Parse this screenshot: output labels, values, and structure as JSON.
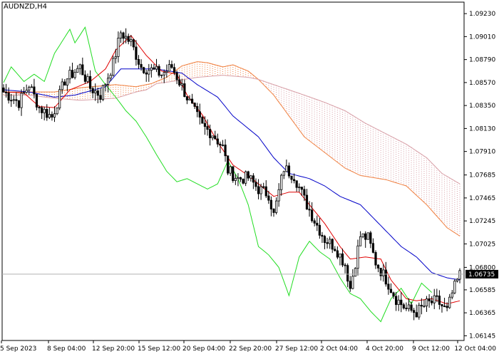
{
  "chart_data": {
    "type": "candlestick",
    "title": "AUDNZD,H4",
    "symbol": "AUDNZD",
    "timeframe": "H4",
    "ylim": [
      1.061,
      1.0934
    ],
    "y_ticks": [
      "1.09230",
      "1.09010",
      "1.08790",
      "1.08570",
      "1.08350",
      "1.08130",
      "1.07910",
      "1.07685",
      "1.07465",
      "1.07245",
      "1.07025",
      "1.06800",
      "1.06585",
      "1.06365",
      "1.06145"
    ],
    "x_ticks": [
      "5 Sep 2023",
      "8 Sep 04:00",
      "12 Sep 20:00",
      "15 Sep 12:00",
      "20 Sep 04:00",
      "22 Sep 20:00",
      "27 Sep 12:00",
      "2 Oct 04:00",
      "4 Oct 20:00",
      "9 Oct 12:00",
      "12 Oct 04:00"
    ],
    "current_price": "1.06735",
    "grid": false,
    "colors": {
      "bull_candle": "#000000",
      "bear_candle": "#000000",
      "tenkan_sen": "#e00000",
      "kijun_sen": "#0000c8",
      "chikou_span": "#22dd22",
      "cloud_bull": "#f08040",
      "cloud_bear": "#d8a0a8",
      "price_line": "#b0b0b0",
      "price_tag_bg": "#000000",
      "price_tag_text": "#ffffff"
    },
    "price_keyframes": [
      [
        0,
        1.0848
      ],
      [
        6,
        1.0838
      ],
      [
        10,
        1.0855
      ],
      [
        14,
        1.0833
      ],
      [
        19,
        1.0824
      ],
      [
        24,
        1.0859
      ],
      [
        30,
        1.0872
      ],
      [
        34,
        1.0852
      ],
      [
        38,
        1.0845
      ],
      [
        43,
        1.0875
      ],
      [
        46,
        1.0905
      ],
      [
        50,
        1.0895
      ],
      [
        54,
        1.0872
      ],
      [
        58,
        1.0869
      ],
      [
        62,
        1.0865
      ],
      [
        66,
        1.0872
      ],
      [
        70,
        1.0853
      ],
      [
        74,
        1.0833
      ],
      [
        78,
        1.0815
      ],
      [
        82,
        1.0808
      ],
      [
        86,
        1.0795
      ],
      [
        88,
        1.0773
      ],
      [
        92,
        1.0765
      ],
      [
        96,
        1.0766
      ],
      [
        100,
        1.0755
      ],
      [
        104,
        1.075
      ],
      [
        106,
        1.073
      ],
      [
        110,
        1.0775
      ],
      [
        114,
        1.0768
      ],
      [
        118,
        1.0745
      ],
      [
        122,
        1.0725
      ],
      [
        126,
        1.0707
      ],
      [
        130,
        1.07
      ],
      [
        134,
        1.0683
      ],
      [
        136,
        1.066
      ],
      [
        140,
        1.071
      ],
      [
        143,
        1.0708
      ],
      [
        146,
        1.0685
      ],
      [
        150,
        1.0669
      ],
      [
        154,
        1.065
      ],
      [
        158,
        1.064
      ],
      [
        162,
        1.0637
      ],
      [
        166,
        1.0645
      ],
      [
        170,
        1.0648
      ],
      [
        174,
        1.0638
      ],
      [
        176,
        1.0655
      ],
      [
        179,
        1.0673
      ]
    ],
    "tenkan_keyframes": [
      [
        0,
        1.0848
      ],
      [
        8,
        1.0847
      ],
      [
        14,
        1.0834
      ],
      [
        20,
        1.0833
      ],
      [
        26,
        1.085
      ],
      [
        34,
        1.0858
      ],
      [
        40,
        1.087
      ],
      [
        44,
        1.0888
      ],
      [
        50,
        1.0902
      ],
      [
        56,
        1.0883
      ],
      [
        62,
        1.0868
      ],
      [
        68,
        1.0865
      ],
      [
        72,
        1.0845
      ],
      [
        78,
        1.0826
      ],
      [
        84,
        1.08
      ],
      [
        90,
        1.0778
      ],
      [
        96,
        1.0768
      ],
      [
        100,
        1.076
      ],
      [
        106,
        1.0748
      ],
      [
        112,
        1.0752
      ],
      [
        116,
        1.0752
      ],
      [
        120,
        1.074
      ],
      [
        126,
        1.0722
      ],
      [
        132,
        1.07
      ],
      [
        136,
        1.0688
      ],
      [
        142,
        1.069
      ],
      [
        148,
        1.0688
      ],
      [
        152,
        1.0668
      ],
      [
        158,
        1.065
      ],
      [
        162,
        1.0648
      ],
      [
        168,
        1.065
      ],
      [
        174,
        1.0645
      ],
      [
        179,
        1.0648
      ]
    ],
    "kijun_keyframes": [
      [
        0,
        1.085
      ],
      [
        10,
        1.0848
      ],
      [
        20,
        1.0843
      ],
      [
        28,
        1.0845
      ],
      [
        40,
        1.0853
      ],
      [
        46,
        1.087
      ],
      [
        60,
        1.087
      ],
      [
        70,
        1.0866
      ],
      [
        76,
        1.0855
      ],
      [
        84,
        1.0843
      ],
      [
        90,
        1.0825
      ],
      [
        100,
        1.0805
      ],
      [
        106,
        1.0785
      ],
      [
        112,
        1.077
      ],
      [
        120,
        1.0765
      ],
      [
        126,
        1.0758
      ],
      [
        132,
        1.0748
      ],
      [
        140,
        1.074
      ],
      [
        148,
        1.072
      ],
      [
        156,
        1.07
      ],
      [
        162,
        1.069
      ],
      [
        168,
        1.0675
      ],
      [
        174,
        1.067
      ],
      [
        179,
        1.0668
      ]
    ],
    "chikou_keyframes": [
      [
        0,
        1.0857
      ],
      [
        3,
        1.0872
      ],
      [
        8,
        1.0858
      ],
      [
        12,
        1.0865
      ],
      [
        16,
        1.0858
      ],
      [
        20,
        1.0885
      ],
      [
        26,
        1.0908
      ],
      [
        28,
        1.0895
      ],
      [
        32,
        1.091
      ],
      [
        36,
        1.0868
      ],
      [
        40,
        1.0855
      ],
      [
        44,
        1.0843
      ],
      [
        48,
        1.083
      ],
      [
        52,
        1.082
      ],
      [
        56,
        1.0805
      ],
      [
        60,
        1.0788
      ],
      [
        64,
        1.0772
      ],
      [
        68,
        1.0762
      ],
      [
        72,
        1.0765
      ],
      [
        76,
        1.076
      ],
      [
        80,
        1.0755
      ],
      [
        84,
        1.076
      ],
      [
        88,
        1.0782
      ],
      [
        92,
        1.0765
      ],
      [
        96,
        1.074
      ],
      [
        100,
        1.07
      ],
      [
        104,
        1.0692
      ],
      [
        108,
        1.068
      ],
      [
        112,
        1.0653
      ],
      [
        116,
        1.069
      ],
      [
        120,
        1.0705
      ],
      [
        124,
        1.0695
      ],
      [
        128,
        1.0688
      ],
      [
        132,
        1.067
      ],
      [
        136,
        1.0655
      ],
      [
        140,
        1.065
      ],
      [
        144,
        1.0638
      ],
      [
        148,
        1.0628
      ],
      [
        152,
        1.065
      ],
      [
        156,
        1.066
      ],
      [
        160,
        1.0645
      ],
      [
        162,
        1.0655
      ],
      [
        164,
        1.0665
      ],
      [
        168,
        1.0656
      ]
    ],
    "senkou_a_keyframes": [
      [
        0,
        1.0848
      ],
      [
        10,
        1.0848
      ],
      [
        20,
        1.0848
      ],
      [
        30,
        1.0852
      ],
      [
        44,
        1.0855
      ],
      [
        52,
        1.0853
      ],
      [
        58,
        1.0856
      ],
      [
        64,
        1.0862
      ],
      [
        70,
        1.0873
      ],
      [
        76,
        1.0877
      ],
      [
        80,
        1.0876
      ],
      [
        86,
        1.0872
      ],
      [
        90,
        1.0874
      ],
      [
        96,
        1.0868
      ],
      [
        100,
        1.086
      ],
      [
        106,
        1.0845
      ],
      [
        112,
        1.0825
      ],
      [
        118,
        1.0805
      ],
      [
        126,
        1.079
      ],
      [
        134,
        1.0775
      ],
      [
        140,
        1.0768
      ],
      [
        150,
        1.0764
      ],
      [
        158,
        1.0758
      ],
      [
        166,
        1.074
      ],
      [
        174,
        1.0718
      ],
      [
        179,
        1.071
      ]
    ],
    "senkou_b_keyframes": [
      [
        0,
        1.0845
      ],
      [
        10,
        1.0845
      ],
      [
        20,
        1.0842
      ],
      [
        30,
        1.084
      ],
      [
        44,
        1.0842
      ],
      [
        52,
        1.0848
      ],
      [
        56,
        1.085
      ],
      [
        60,
        1.0856
      ],
      [
        66,
        1.0858
      ],
      [
        76,
        1.0862
      ],
      [
        86,
        1.0864
      ],
      [
        96,
        1.0862
      ],
      [
        100,
        1.086
      ],
      [
        106,
        1.0855
      ],
      [
        112,
        1.085
      ],
      [
        118,
        1.0845
      ],
      [
        126,
        1.0838
      ],
      [
        134,
        1.083
      ],
      [
        142,
        1.0818
      ],
      [
        150,
        1.0808
      ],
      [
        158,
        1.0798
      ],
      [
        166,
        1.0785
      ],
      [
        172,
        1.077
      ],
      [
        179,
        1.076
      ]
    ]
  }
}
